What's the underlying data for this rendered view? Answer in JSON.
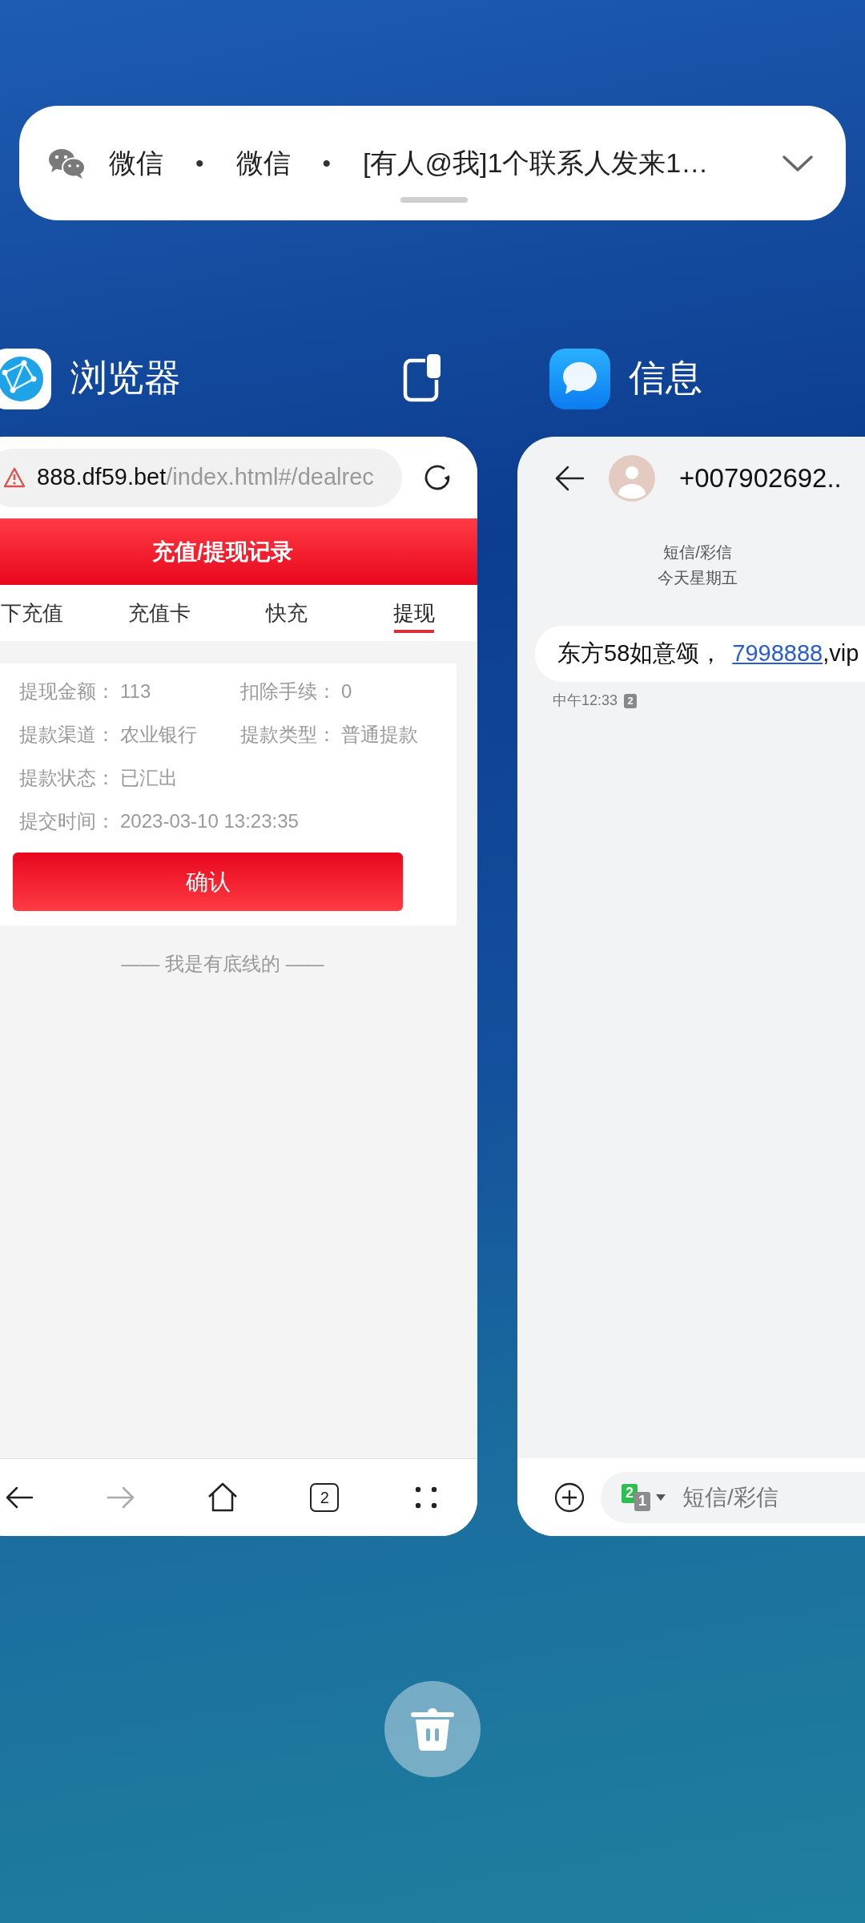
{
  "notification": {
    "parts": [
      {
        "kind": "text",
        "text": "微信"
      },
      {
        "kind": "separator",
        "text": "•"
      },
      {
        "kind": "text",
        "text": "微信"
      },
      {
        "kind": "separator",
        "text": "•"
      },
      {
        "kind": "text",
        "text": "[有人@我]1个联系人发来1…"
      }
    ]
  },
  "browser_card": {
    "title": "浏览器",
    "url_host": "888.df59.bet",
    "url_path": "/index.html#/dealrec",
    "page_title": "充值/提现记录",
    "tabs": [
      {
        "label": "下充值",
        "selected": false
      },
      {
        "label": "充值卡",
        "selected": false
      },
      {
        "label": "快充",
        "selected": false
      },
      {
        "label": "提现",
        "selected": true
      }
    ],
    "detail_rows": [
      [
        {
          "label": "提现金额：",
          "value": "113"
        },
        {
          "label": "扣除手续：",
          "value": "0"
        }
      ],
      [
        {
          "label": "提款渠道：",
          "value": "农业银行"
        },
        {
          "label": "提款类型：",
          "value": "普通提款"
        }
      ],
      [
        {
          "label": "提款状态：",
          "value": "已汇出"
        }
      ],
      [
        {
          "label": "提交时间：",
          "value": "2023-03-10 13:23:35"
        }
      ]
    ],
    "confirm_button": "确认",
    "footer": "—— 我是有底线的 ——",
    "nav": [
      {
        "kind": "back",
        "disabled": false
      },
      {
        "kind": "forward",
        "disabled": true
      },
      {
        "kind": "home",
        "disabled": false
      },
      {
        "kind": "tabs",
        "text": "2",
        "disabled": false
      },
      {
        "kind": "menu",
        "disabled": false
      }
    ]
  },
  "messages_card": {
    "title": "信息",
    "contact": "+007902692..",
    "thread_label": "短信/彩信",
    "date": "今天星期五",
    "messages": [
      {
        "text": "东方58如意颂，",
        "link": "7998888",
        "tail": ",vip",
        "time": "中午12:33",
        "sim": "2"
      }
    ],
    "composer": {
      "sim_primary": "2",
      "sim_secondary": "1",
      "placeholder": "短信/彩信"
    }
  }
}
